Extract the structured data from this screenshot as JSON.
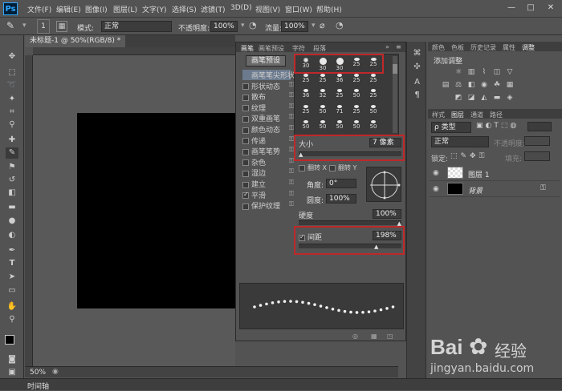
{
  "app": {
    "logo": "Ps"
  },
  "menu": [
    "文件(F)",
    "编辑(E)",
    "图像(I)",
    "图层(L)",
    "文字(Y)",
    "选择(S)",
    "滤镜(T)",
    "3D(D)",
    "视图(V)",
    "窗口(W)",
    "帮助(H)"
  ],
  "window_buttons": [
    "—",
    "□",
    "✕"
  ],
  "options": {
    "brush_size": "1",
    "mode_label": "模式:",
    "mode_value": "正常",
    "opacity_label": "不透明度:",
    "opacity_value": "100%",
    "flow_label": "流量:",
    "flow_value": "100%"
  },
  "document_tab": "未标题-1 @ 50%(RGB/8) *",
  "status": {
    "zoom": "50%"
  },
  "timeline_label": "时间轴",
  "brush_panel": {
    "tabs": [
      "画笔",
      "画笔预设",
      "字符",
      "段落"
    ],
    "preset_button": "画笔预设",
    "options": [
      {
        "label": "画笔笔尖形状",
        "checked": false,
        "selected": true,
        "lock": false
      },
      {
        "label": "形状动态",
        "checked": false,
        "selected": false,
        "lock": true
      },
      {
        "label": "散布",
        "checked": false,
        "selected": false,
        "lock": true
      },
      {
        "label": "纹理",
        "checked": false,
        "selected": false,
        "lock": true
      },
      {
        "label": "双重画笔",
        "checked": false,
        "selected": false,
        "lock": true
      },
      {
        "label": "颜色动态",
        "checked": false,
        "selected": false,
        "lock": true
      },
      {
        "label": "传递",
        "checked": false,
        "selected": false,
        "lock": true
      },
      {
        "label": "画笔笔势",
        "checked": false,
        "selected": false,
        "lock": true
      },
      {
        "label": "杂色",
        "checked": false,
        "selected": false,
        "lock": true
      },
      {
        "label": "湿边",
        "checked": false,
        "selected": false,
        "lock": true
      },
      {
        "label": "建立",
        "checked": false,
        "selected": false,
        "lock": true
      },
      {
        "label": "平滑",
        "checked": true,
        "selected": false,
        "lock": true
      },
      {
        "label": "保护纹理",
        "checked": false,
        "selected": false,
        "lock": true
      }
    ],
    "tip_sizes": [
      [
        "30",
        "30",
        "30",
        "25",
        "25"
      ],
      [
        "25",
        "25",
        "36",
        "25",
        "25"
      ],
      [
        "36",
        "32",
        "25",
        "50",
        "25"
      ],
      [
        "25",
        "50",
        "71",
        "25",
        "50"
      ],
      [
        "50",
        "50",
        "50",
        "50",
        "50"
      ]
    ],
    "size_label": "大小",
    "size_value": "7 像素",
    "flip_x": "翻转 X",
    "flip_y": "翻转 Y",
    "angle_label": "角度:",
    "angle_value": "0°",
    "roundness_label": "圆度:",
    "roundness_value": "100%",
    "hardness_label": "硬度",
    "hardness_value": "100%",
    "spacing_label": "间距",
    "spacing_value": "198%"
  },
  "adjust_panel": {
    "tabs": [
      "颜色",
      "色板",
      "历史记录",
      "属性",
      "调整"
    ],
    "title": "添加调整"
  },
  "layers_panel": {
    "tabs": [
      "样式",
      "图层",
      "通道",
      "路径"
    ],
    "filter_label": "ρ 类型",
    "blend_mode": "正常",
    "opacity_label": "不透明度:",
    "lock_label": "锁定:",
    "fill_label": "填充:",
    "layers": [
      {
        "name": "图层 1",
        "type": "transparent"
      },
      {
        "name": "背景",
        "type": "black"
      }
    ]
  },
  "watermark": {
    "brand": "Bai",
    "brand_cn": "经验",
    "url": "jingyan.baidu.com"
  },
  "colors": {
    "accent_red": "#c0282a",
    "panel_bg": "#535353",
    "selected": "#6b7a8d"
  }
}
